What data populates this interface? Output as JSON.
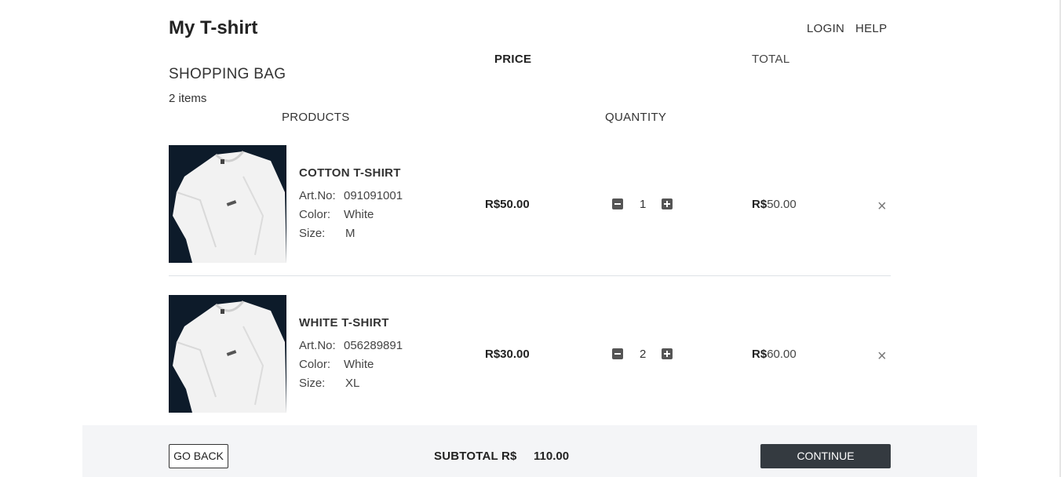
{
  "header": {
    "brand": "My T-shirt",
    "login": "LOGIN",
    "help": "HELP"
  },
  "bag": {
    "title": "SHOPPING BAG",
    "count": "2 items"
  },
  "columns": {
    "products": "PRODUCTS",
    "price": "PRICE",
    "quantity": "QUANTITY",
    "total": "TOTAL"
  },
  "labels": {
    "art": "Art.No:",
    "color": "Color:",
    "size": "Size:"
  },
  "items": [
    {
      "name": "COTTON T-SHIRT",
      "art_no": "091091001",
      "color": "White",
      "size": "M",
      "price": "R$50.00",
      "quantity": "1",
      "total_currency": "R$",
      "total_amount": "50.00",
      "remove_icon": "×"
    },
    {
      "name": "WHITE T-SHIRT",
      "art_no": "056289891",
      "color": "White",
      "size": "XL",
      "price": "R$30.00",
      "quantity": "2",
      "total_currency": "R$",
      "total_amount": "60.00",
      "remove_icon": "×"
    }
  ],
  "footer": {
    "go_back": "GO BACK",
    "subtotal_label": "SUBTOTAL R$",
    "subtotal_value": "110.00",
    "continue": "CONTINUE"
  },
  "icons": {
    "thumbnail": "white-tshirt-image",
    "minus": "minus-square-icon",
    "plus": "plus-square-icon",
    "remove": "close-icon"
  },
  "colors": {
    "accent_dark": "#343a40",
    "footer_bg": "#f4f5f7"
  }
}
